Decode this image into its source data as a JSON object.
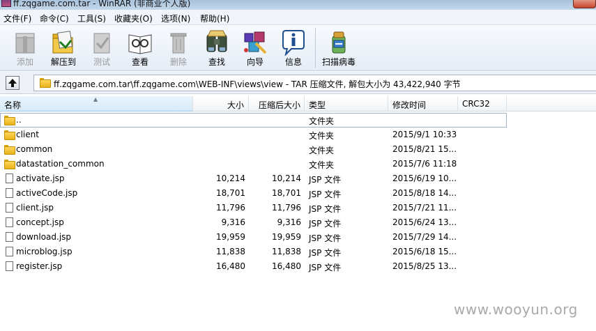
{
  "window": {
    "title": "ff.zqgame.com.tar - WinRAR (非商业个人版)"
  },
  "menu": [
    "文件(F)",
    "命令(C)",
    "工具(S)",
    "收藏夹(O)",
    "选项(N)",
    "帮助(H)"
  ],
  "toolbar": {
    "buttons": [
      {
        "label": "添加",
        "icon": "add-archive-icon",
        "enabled": false
      },
      {
        "label": "解压到",
        "icon": "extract-to-icon",
        "enabled": true
      },
      {
        "label": "测试",
        "icon": "test-icon",
        "enabled": false
      },
      {
        "label": "查看",
        "icon": "view-icon",
        "enabled": true
      },
      {
        "label": "删除",
        "icon": "delete-icon",
        "enabled": false
      },
      {
        "label": "查找",
        "icon": "find-icon",
        "enabled": true
      },
      {
        "label": "向导",
        "icon": "wizard-icon",
        "enabled": true
      },
      {
        "label": "信息",
        "icon": "info-icon",
        "enabled": true
      },
      {
        "label": "扫描病毒",
        "icon": "virus-scan-icon",
        "enabled": true
      }
    ]
  },
  "address": {
    "up_icon": "up-folder-icon",
    "path": "ff.zqgame.com.tar\\ff.zqgame.com\\WEB-INF\\views\\view - TAR 压缩文件, 解包大小为 43,422,940 字节"
  },
  "columns": {
    "name": "名称",
    "size": "大小",
    "packed": "压缩后大小",
    "type": "类型",
    "modified": "修改时间",
    "crc": "CRC32"
  },
  "files": [
    {
      "name": "..",
      "size": "",
      "packed": "",
      "type": "文件夹",
      "modified": "",
      "kind": "folder"
    },
    {
      "name": "client",
      "size": "",
      "packed": "",
      "type": "文件夹",
      "modified": "2015/9/1 10:33",
      "kind": "folder"
    },
    {
      "name": "common",
      "size": "",
      "packed": "",
      "type": "文件夹",
      "modified": "2015/8/21 15...",
      "kind": "folder"
    },
    {
      "name": "datastation_common",
      "size": "",
      "packed": "",
      "type": "文件夹",
      "modified": "2015/7/6 11:18",
      "kind": "folder"
    },
    {
      "name": "activate.jsp",
      "size": "10,214",
      "packed": "10,214",
      "type": "JSP 文件",
      "modified": "2015/6/19 10...",
      "kind": "file"
    },
    {
      "name": "activeCode.jsp",
      "size": "18,701",
      "packed": "18,701",
      "type": "JSP 文件",
      "modified": "2015/8/18 14...",
      "kind": "file"
    },
    {
      "name": "client.jsp",
      "size": "11,796",
      "packed": "11,796",
      "type": "JSP 文件",
      "modified": "2015/7/21 11...",
      "kind": "file"
    },
    {
      "name": "concept.jsp",
      "size": "9,316",
      "packed": "9,316",
      "type": "JSP 文件",
      "modified": "2015/6/24 13...",
      "kind": "file"
    },
    {
      "name": "download.jsp",
      "size": "19,959",
      "packed": "19,959",
      "type": "JSP 文件",
      "modified": "2015/7/29 14...",
      "kind": "file"
    },
    {
      "name": "microblog.jsp",
      "size": "11,838",
      "packed": "11,838",
      "type": "JSP 文件",
      "modified": "2015/6/18 15...",
      "kind": "file"
    },
    {
      "name": "register.jsp",
      "size": "16,480",
      "packed": "16,480",
      "type": "JSP 文件",
      "modified": "2015/8/25 13...",
      "kind": "file"
    }
  ],
  "watermark": "www.wooyun.org"
}
